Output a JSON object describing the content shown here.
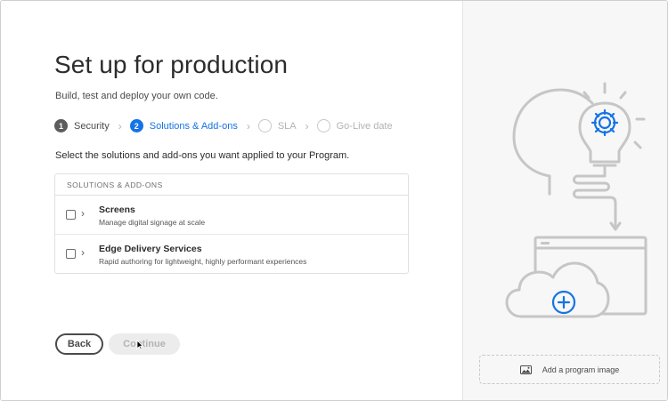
{
  "header": {
    "title": "Set up for production",
    "subtitle": "Build, test and deploy your own code."
  },
  "steps": [
    {
      "number": "1",
      "label": "Security",
      "state": "done"
    },
    {
      "number": "2",
      "label": "Solutions & Add-ons",
      "state": "active"
    },
    {
      "number": "",
      "label": "SLA",
      "state": "pending"
    },
    {
      "number": "",
      "label": "Go-Live date",
      "state": "pending"
    }
  ],
  "instruction": "Select the solutions and add-ons you want applied to your Program.",
  "table": {
    "header": "SOLUTIONS & ADD-ONS",
    "rows": [
      {
        "title": "Screens",
        "description": "Manage digital signage at scale",
        "checked": false
      },
      {
        "title": "Edge Delivery Services",
        "description": "Rapid authoring for lightweight, highly performant experiences",
        "checked": false
      }
    ]
  },
  "buttons": {
    "back": "Back",
    "continue": "Continue"
  },
  "side": {
    "add_image_label": "Add a program image"
  },
  "colors": {
    "accent": "#1473e6",
    "illustration_stroke": "#c6c6c6",
    "illustration_icon": "#1473e6"
  }
}
